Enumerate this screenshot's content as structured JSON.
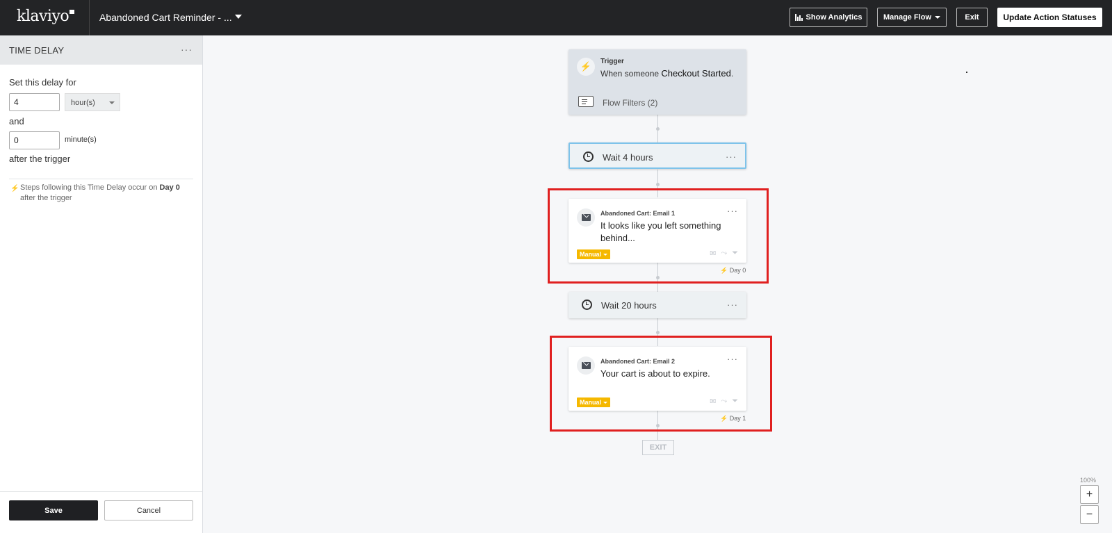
{
  "header": {
    "logo": "klaviyo",
    "flow_title": "Abandoned Cart Reminder - ...",
    "show_analytics": "Show Analytics",
    "manage_flow": "Manage Flow",
    "exit": "Exit",
    "update_action_statuses": "Update Action Statuses"
  },
  "panel": {
    "title": "TIME DELAY",
    "menu": "···",
    "set_delay_label": "Set this delay for",
    "hours_value": "4",
    "hours_unit": "hour(s)",
    "and_label": "and",
    "minutes_value": "0",
    "minutes_unit": "minute(s)",
    "after_label": "after the trigger",
    "note_prefix": "Steps following this Time Delay occur on",
    "note_day": "Day 0",
    "note_suffix": "after the trigger",
    "save": "Save",
    "cancel": "Cancel"
  },
  "flow": {
    "trigger": {
      "label": "Trigger",
      "text_prefix": "When someone",
      "event": "Checkout Started",
      "text_suffix": ".",
      "filters": "Flow Filters (2)"
    },
    "wait1": "Wait 4 hours",
    "email1": {
      "name": "Abandoned Cart: Email 1",
      "subject": "It looks like you left something behind...",
      "status": "Manual",
      "day": "Day 0"
    },
    "wait2": "Wait 20 hours",
    "email2": {
      "name": "Abandoned Cart: Email 2",
      "subject": "Your cart is about to expire.",
      "status": "Manual",
      "day": "Day 1"
    },
    "exit": "EXIT",
    "menu": "···"
  },
  "zoom": {
    "level": "100%",
    "plus": "+",
    "minus": "−"
  },
  "colors": {
    "topbar": "#232426",
    "badge": "#f5b800",
    "highlight": "#e02020",
    "selected_border": "#7ec3ea"
  }
}
